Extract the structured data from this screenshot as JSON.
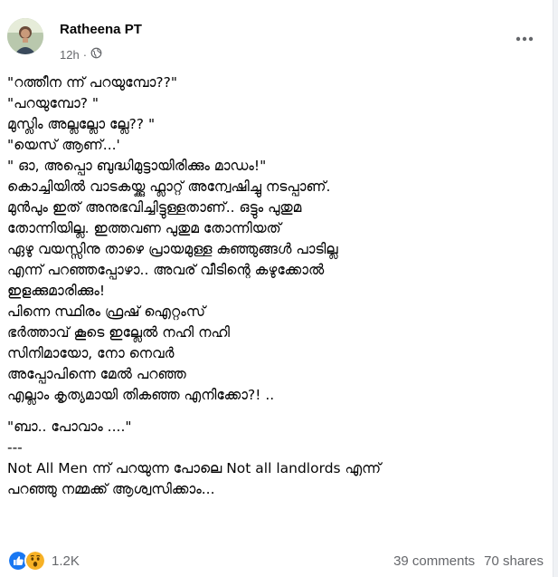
{
  "post": {
    "author": "Ratheena PT",
    "timestamp": "12h",
    "audience_icon": "globe-icon",
    "more_icon": "more-horizontal-icon",
    "lines": [
      "\"റത്തീന ന്ന് പറയുമ്പോ??\"",
      "\"പറയുമ്പോ? \"",
      "മുസ്ലിം അല്ലല്ലോ ല്ലേ?? \"",
      "\"യെസ് ആണ്...'",
      "\" ഓ, അപ്പൊ  ബുദ്ധിമുട്ടായിരിക്കും  മാഡം!\"",
      "കൊച്ചിയിൽ വാടകയ്ക്കു ഫ്ലാറ്റ് അന്വേഷിച്ചു നടപ്പാണ്.",
      "മുൻപും ഇത് അനുഭവിച്ചിട്ടുള്ളതാണ്.. ഒട്ടും പുതുമ",
      "തോന്നിയില്ല.  ഇത്തവണ പുതുമ തോന്നിയത്",
      "ഏഴു വയസ്സിനു താഴെ പ്രായമുള്ള കുഞ്ഞുങ്ങൾ പാടില്ല",
      "എന്ന് പറഞ്ഞപ്പോഴാ.. അവര് വീടിന്റെ കഴുക്കോൽ",
      "ഇളക്കുമാരിക്കും!",
      "പിന്നെ സ്ഥിരം ഫ്രഷ് ഐറ്റംസ്",
      "ഭർത്താവ് കൂടെ ഇല്ലേൽ നഹി നഹി",
      "സിനിമായോ, നോ നെവർ",
      "അപ്പോപിന്നെ മേൽ പറഞ്ഞ",
      "എല്ലാം കൃത്യമായി തികഞ്ഞ  എനിക്കോ?! .."
    ],
    "line_after_gap": "\"ബാ.. പോവാം ....\"",
    "separator": "---",
    "closing_lines": [
      "Not All Men ന്ന് പറയുന്ന പോലെ  Not all landlords എന്ന്",
      "പറഞ്ഞു  നമ്മക്ക് ആശ്വസിക്കാം..."
    ]
  },
  "stats": {
    "reactions": [
      "like-icon",
      "wow-icon"
    ],
    "reaction_count": "1.2K",
    "comments": "39 comments",
    "shares": "70 shares"
  },
  "colors": {
    "like_blue": "#1877f2",
    "wow_yellow": "#f7b125",
    "secondary_text": "#65676b"
  }
}
